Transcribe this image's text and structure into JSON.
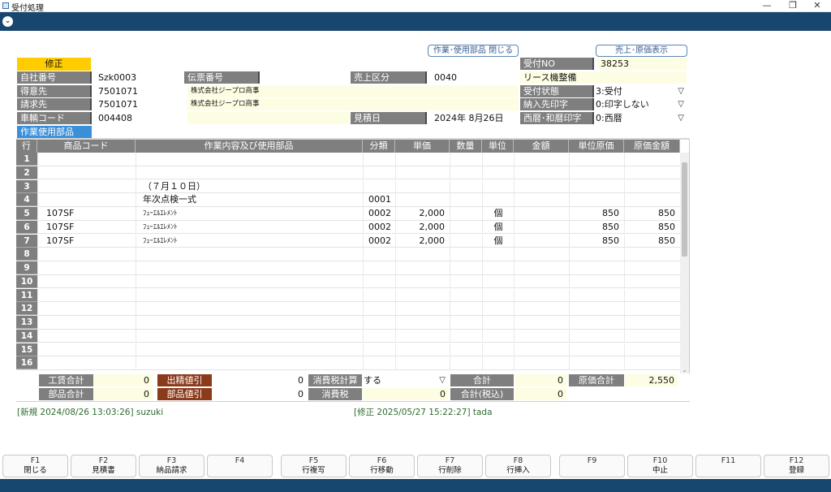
{
  "window": {
    "title": "受付処理",
    "controls": [
      "—",
      "❐",
      "✕"
    ]
  },
  "header_buttons": {
    "close_parts": "作業･使用部品 閉じる",
    "show_cost": "売上･原価表示"
  },
  "mode": "修正",
  "form": {
    "jisha_label": "自社番号",
    "jisha_value": "Szk0003",
    "denpyo_label": "伝票番号",
    "denpyo_value": "",
    "uriage_label": "売上区分",
    "uriage_value": "0040",
    "tokui_label": "得意先",
    "tokui_code": "7501071",
    "tokui_name": "株式会社ジープロ商事",
    "seikyu_label": "請求先",
    "seikyu_code": "7501071",
    "seikyu_name": "株式会社ジープロ商事",
    "sharyo_label": "車輌コード",
    "sharyo_value": "004408",
    "mitsumori_label": "見積日",
    "mitsumori_value": "2024年  8月26日",
    "uketsuke_no_label": "受付NO",
    "uketsuke_no_value": "38253",
    "lease_label": "リース機整備",
    "uketsuke_state_label": "受付状態",
    "uketsuke_state_value": "3:受付",
    "nonyu_label": "納入先印字",
    "nonyu_value": "0:印字しない",
    "seireki_label": "西暦･和暦印字",
    "seireki_value": "0:西暦"
  },
  "section_tab": "作業使用部品",
  "table": {
    "headers": [
      "行",
      "商品コード",
      "作業内容及び使用部品",
      "分類",
      "単価",
      "数量",
      "単位",
      "金額",
      "単位原価",
      "原価金額"
    ],
    "rows": [
      {
        "n": "1",
        "code": "",
        "desc": "",
        "cat": "",
        "price": "",
        "qty": "",
        "unit": "",
        "amt": "",
        "ucost": "",
        "cost": ""
      },
      {
        "n": "2",
        "code": "",
        "desc": "",
        "cat": "",
        "price": "",
        "qty": "",
        "unit": "",
        "amt": "",
        "ucost": "",
        "cost": ""
      },
      {
        "n": "3",
        "code": "",
        "desc": "（７月１０日）",
        "cat": "",
        "price": "",
        "qty": "",
        "unit": "",
        "amt": "",
        "ucost": "",
        "cost": ""
      },
      {
        "n": "4",
        "code": "",
        "desc": "年次点検一式",
        "cat": "0001",
        "price": "",
        "qty": "",
        "unit": "",
        "amt": "",
        "ucost": "",
        "cost": ""
      },
      {
        "n": "5",
        "code": "107SF",
        "desc": "ﾌｭｰｴﾙｴﾚﾒﾝﾄ",
        "cat": "0002",
        "price": "2,000",
        "qty": "",
        "unit": "個",
        "amt": "",
        "ucost": "850",
        "cost": "850"
      },
      {
        "n": "6",
        "code": "107SF",
        "desc": "ﾌｭｰｴﾙｴﾚﾒﾝﾄ",
        "cat": "0002",
        "price": "2,000",
        "qty": "",
        "unit": "個",
        "amt": "",
        "ucost": "850",
        "cost": "850"
      },
      {
        "n": "7",
        "code": "107SF",
        "desc": "ﾌｭｰｴﾙｴﾚﾒﾝﾄ",
        "cat": "0002",
        "price": "2,000",
        "qty": "",
        "unit": "個",
        "amt": "",
        "ucost": "850",
        "cost": "850"
      },
      {
        "n": "8",
        "code": "",
        "desc": "",
        "cat": "",
        "price": "",
        "qty": "",
        "unit": "",
        "amt": "",
        "ucost": "",
        "cost": ""
      },
      {
        "n": "9",
        "code": "",
        "desc": "",
        "cat": "",
        "price": "",
        "qty": "",
        "unit": "",
        "amt": "",
        "ucost": "",
        "cost": ""
      },
      {
        "n": "10",
        "code": "",
        "desc": "",
        "cat": "",
        "price": "",
        "qty": "",
        "unit": "",
        "amt": "",
        "ucost": "",
        "cost": ""
      },
      {
        "n": "11",
        "code": "",
        "desc": "",
        "cat": "",
        "price": "",
        "qty": "",
        "unit": "",
        "amt": "",
        "ucost": "",
        "cost": ""
      },
      {
        "n": "12",
        "code": "",
        "desc": "",
        "cat": "",
        "price": "",
        "qty": "",
        "unit": "",
        "amt": "",
        "ucost": "",
        "cost": ""
      },
      {
        "n": "13",
        "code": "",
        "desc": "",
        "cat": "",
        "price": "",
        "qty": "",
        "unit": "",
        "amt": "",
        "ucost": "",
        "cost": ""
      },
      {
        "n": "14",
        "code": "",
        "desc": "",
        "cat": "",
        "price": "",
        "qty": "",
        "unit": "",
        "amt": "",
        "ucost": "",
        "cost": ""
      },
      {
        "n": "15",
        "code": "",
        "desc": "",
        "cat": "",
        "price": "",
        "qty": "",
        "unit": "",
        "amt": "",
        "ucost": "",
        "cost": ""
      },
      {
        "n": "16",
        "code": "",
        "desc": "",
        "cat": "",
        "price": "",
        "qty": "",
        "unit": "",
        "amt": "",
        "ucost": "",
        "cost": ""
      }
    ]
  },
  "totals": {
    "kochin_label": "工賃合計",
    "kochin_value": "0",
    "shusei_label": "出精値引",
    "shusei_value": "0",
    "tax_calc_label": "消費税計算",
    "tax_calc_value": "する",
    "gokei_label": "合計",
    "gokei_value": "0",
    "genka_label": "原価合計",
    "genka_value": "2,550",
    "buhin_label": "部品合計",
    "buhin_value": "0",
    "buhin_nebiki_label": "部品値引",
    "buhin_nebiki_value": "0",
    "tax_label": "消費税",
    "tax_value": "0",
    "gokei_tax_label": "合計(税込)",
    "gokei_tax_value": "0"
  },
  "status": {
    "created": "[新規 2024/08/26 13:03:26] suzuki",
    "modified": "[修正 2025/05/27 15:22:27] tada"
  },
  "fkeys": [
    {
      "key": "F1",
      "label": "閉じる"
    },
    {
      "key": "F2",
      "label": "見積書"
    },
    {
      "key": "F3",
      "label": "納品請求"
    },
    {
      "key": "F4",
      "label": ""
    },
    {
      "key": "F5",
      "label": "行複写"
    },
    {
      "key": "F6",
      "label": "行移動"
    },
    {
      "key": "F7",
      "label": "行削除"
    },
    {
      "key": "F8",
      "label": "行挿入"
    },
    {
      "key": "F9",
      "label": ""
    },
    {
      "key": "F10",
      "label": "中止"
    },
    {
      "key": "F11",
      "label": ""
    },
    {
      "key": "F12",
      "label": "登録"
    }
  ]
}
